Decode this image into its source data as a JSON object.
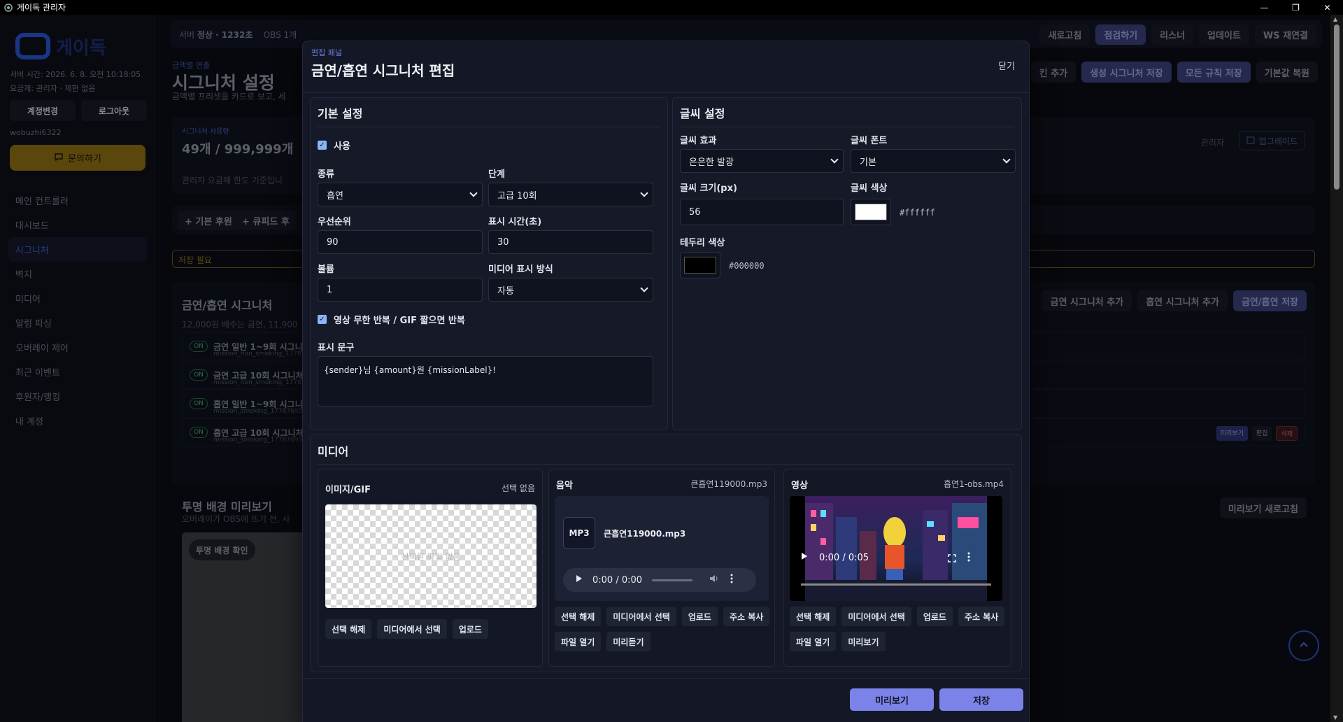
{
  "window": {
    "title": "게이독 관리자",
    "minimize": "—",
    "restore": "❐",
    "close": "✕"
  },
  "sidebar": {
    "logo_text": "게이독",
    "server_time": "서버 시간: 2026. 6. 8. 오전 10:18:05",
    "plan": "요금제: 관리자 · 제한 없음",
    "account_change": "계정변경",
    "logout": "로그아웃",
    "username": "wobuzhi6322",
    "inquire": "문의하기",
    "items": [
      "메인 컨트롤러",
      "대시보드",
      "시그니처",
      "벽지",
      "미디어",
      "알림 파싱",
      "오버레이 제어",
      "최근 이벤트",
      "후원자/랭킹",
      "내 계정"
    ]
  },
  "topbar": {
    "status_prefix": "서버",
    "status_value": "정상 · 1232초",
    "obs": "OBS 1개",
    "buttons": [
      "새로고침",
      "점검하기",
      "리스너",
      "업데이트",
      "WS 재연결"
    ]
  },
  "page": {
    "crumb": "금액별 연출",
    "title": "시그니처 설정",
    "subtitle": "금액별 프리셋을 카드로 보고, 세",
    "actions": [
      "킨 추가",
      "생성 시그니처 저장",
      "모든 규칙 저장",
      "기본값 복원"
    ],
    "usage_label": "시그니처 사용량",
    "usage_value": "49개 / 999,999개",
    "usage_note": "관리자 요금제 한도 기준입니",
    "usage_admin": "관리자",
    "upgrade": "업그레이드",
    "tabs": [
      "+ 기본 후원",
      "+ 큐피드 후"
    ],
    "save_needed": "저장 필요",
    "sig_heading": "금연/흡연 시그니처",
    "sig_desc": "12,000원 배수는 금연, 11,900",
    "sig_add": [
      "금연 시그니처 추가",
      "흡연 시그니처 추가",
      "금연/흡연 저장"
    ],
    "sig_items": [
      {
        "on": "ON",
        "title": "금연 일반 1~9회 시그니",
        "sub": "mission_non_smoking_17787"
      },
      {
        "on": "ON",
        "title": "금연 고급 10회 시그니처",
        "sub": "mission_non_smoking_17787"
      },
      {
        "on": "ON",
        "title": "흡연 일반 1~9회 시그니",
        "sub": "mission_smoking_177876955"
      },
      {
        "on": "ON",
        "title": "흡연 고급 10회 시그니처",
        "sub": "mission_smoking_177876955"
      }
    ],
    "sig_ops": [
      "미리보기",
      "편집",
      "삭제"
    ],
    "preview_heading": "투명 배경 미리보기",
    "preview_desc": "오버레이가 OBS에 뜨기 전, 사",
    "preview_refresh": "미리보기 새로고침",
    "preview_badge": "투명 배경 확인"
  },
  "modal": {
    "eyebrow": "편집 패널",
    "title": "금연/흡연 시그니처 편집",
    "close": "닫기",
    "basic": {
      "heading": "기본 설정",
      "enabled_label": "사용",
      "type_label": "종류",
      "type_value": "흡연",
      "level_label": "단계",
      "level_value": "고급 10회",
      "priority_label": "우선순위",
      "priority_value": "90",
      "duration_label": "표시 시간(초)",
      "duration_value": "30",
      "volume_label": "볼륨",
      "volume_value": "1",
      "media_mode_label": "미디어 표시 방식",
      "media_mode_value": "자동",
      "loop_label": "영상 무한 반복 / GIF 짧으면 반복",
      "text_label": "표시 문구",
      "text_value": "{sender}님 {amount}원 {missionLabel}!"
    },
    "text": {
      "heading": "글씨 설정",
      "effect_label": "글씨 효과",
      "effect_value": "은은한 발광",
      "font_label": "글씨 폰트",
      "font_value": "기본",
      "size_label": "글씨 크기(px)",
      "size_value": "56",
      "color_label": "글씨 색상",
      "color_value": "#ffffff",
      "stroke_label": "테두리 색상",
      "stroke_value": "#000000"
    },
    "media": {
      "heading": "미디어",
      "image": {
        "label": "이미지/GIF",
        "status": "선택 없음",
        "placeholder": "선택된 파일 없음",
        "buttons": [
          "선택 해제",
          "미디어에서 선택",
          "업로드"
        ]
      },
      "audio": {
        "label": "음악",
        "file": "큰흡연119000.mp3",
        "badge": "MP3",
        "name": "큰흡연119000.mp3",
        "time": "0:00 / 0:00",
        "buttons": [
          "선택 해제",
          "미디어에서 선택",
          "업로드",
          "주소 복사",
          "파일 열기",
          "미리듣기"
        ]
      },
      "video": {
        "label": "영상",
        "file": "흡연1-obs.mp4",
        "time": "0:00 / 0:05",
        "buttons": [
          "선택 해제",
          "미디어에서 선택",
          "업로드",
          "주소 복사",
          "파일 열기",
          "미리보기"
        ]
      }
    },
    "footer": {
      "preview": "미리보기",
      "save": "저장"
    }
  },
  "colors": {
    "accent": "#7b83e8",
    "text_color": "#ffffff",
    "stroke_color": "#000000",
    "on_green": "#4aa873",
    "warning": "#8d7528"
  }
}
